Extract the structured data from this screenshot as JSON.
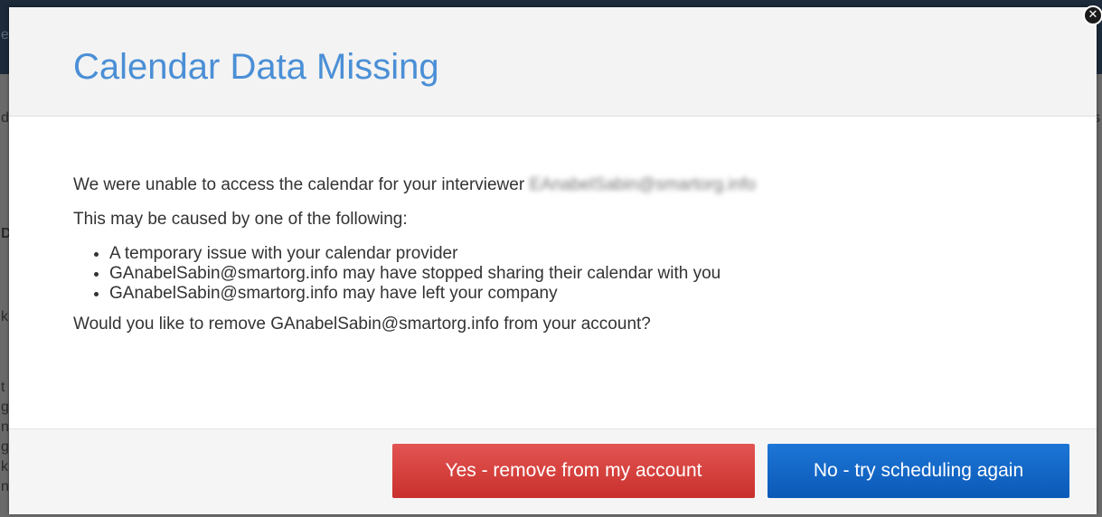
{
  "background": {
    "fragments": [
      "es",
      "d",
      "s",
      "D",
      "k",
      "t",
      "g",
      "n",
      "g",
      "k",
      "n"
    ]
  },
  "modal": {
    "title": "Calendar Data Missing",
    "intro": "We were unable to access the calendar for your interviewer",
    "blurred_email": "EAnabelSabin@smartorg.info",
    "causes_intro": "This may be caused by one of the following:",
    "causes": [
      "A temporary issue with your calendar provider",
      "GAnabelSabin@smartorg.info may have stopped sharing their calendar with you",
      "GAnabelSabin@smartorg.info may have left your company"
    ],
    "question": "Would you like to remove GAnabelSabin@smartorg.info from your account?",
    "buttons": {
      "yes": "Yes - remove from my account",
      "no": "No - try scheduling again"
    },
    "close_icon": "close-icon"
  }
}
